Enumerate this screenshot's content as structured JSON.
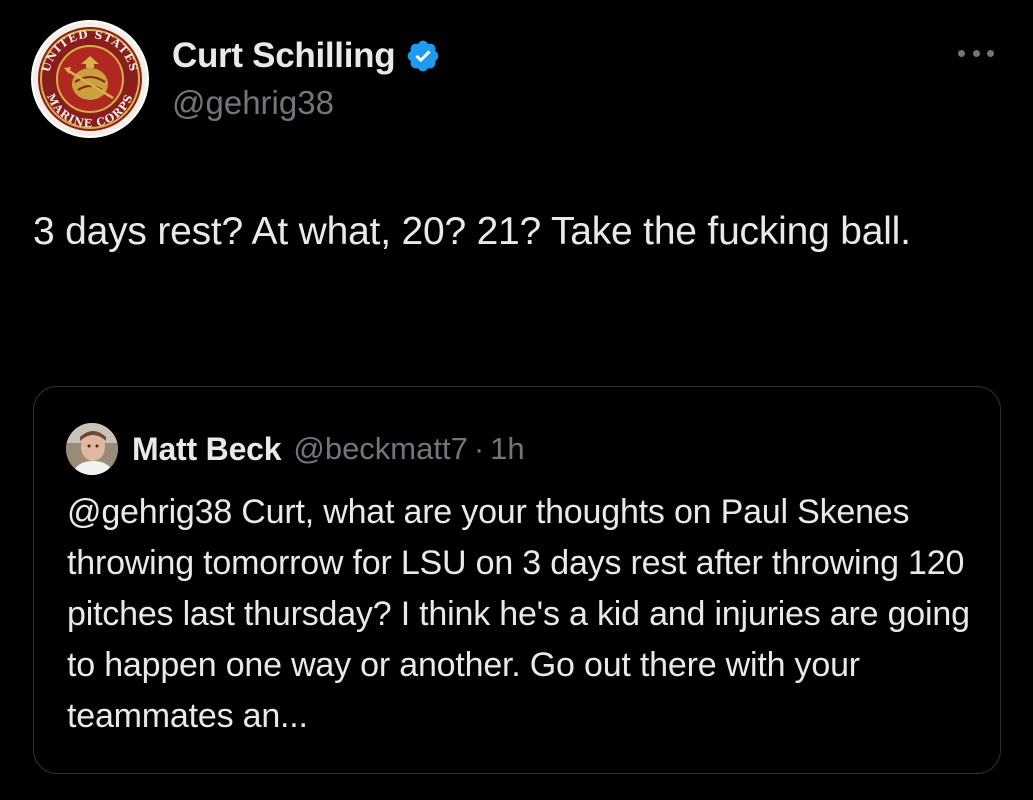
{
  "author": {
    "display_name": "Curt Schilling",
    "handle": "@gehrig38",
    "avatar_icon": "usmc-emblem-icon",
    "avatar_text_top": "UNITED STATES",
    "avatar_text_bottom": "MARINE CORPS",
    "verified": true,
    "verified_icon": "verified-badge-icon",
    "verified_color": "#1d9bf0"
  },
  "more_menu": {
    "icon": "more-options-icon"
  },
  "tweet": {
    "text": "3 days rest? At what, 20? 21? Take the fucking ball."
  },
  "quoted_tweet": {
    "display_name": "Matt Beck",
    "handle": "@beckmatt7",
    "separator": "·",
    "time": "1h",
    "avatar_icon": "user-photo-avatar",
    "text": "@gehrig38  Curt, what are your thoughts on Paul Skenes throwing tomorrow for LSU on 3 days rest after throwing 120 pitches last thursday?  I think he's a kid and injuries are going to happen one way or another.  Go out there with your teammates an..."
  },
  "colors": {
    "background": "#000000",
    "primary_text": "#e7e9ea",
    "secondary_text": "#71767b",
    "border": "#2f3336",
    "accent": "#1d9bf0"
  }
}
